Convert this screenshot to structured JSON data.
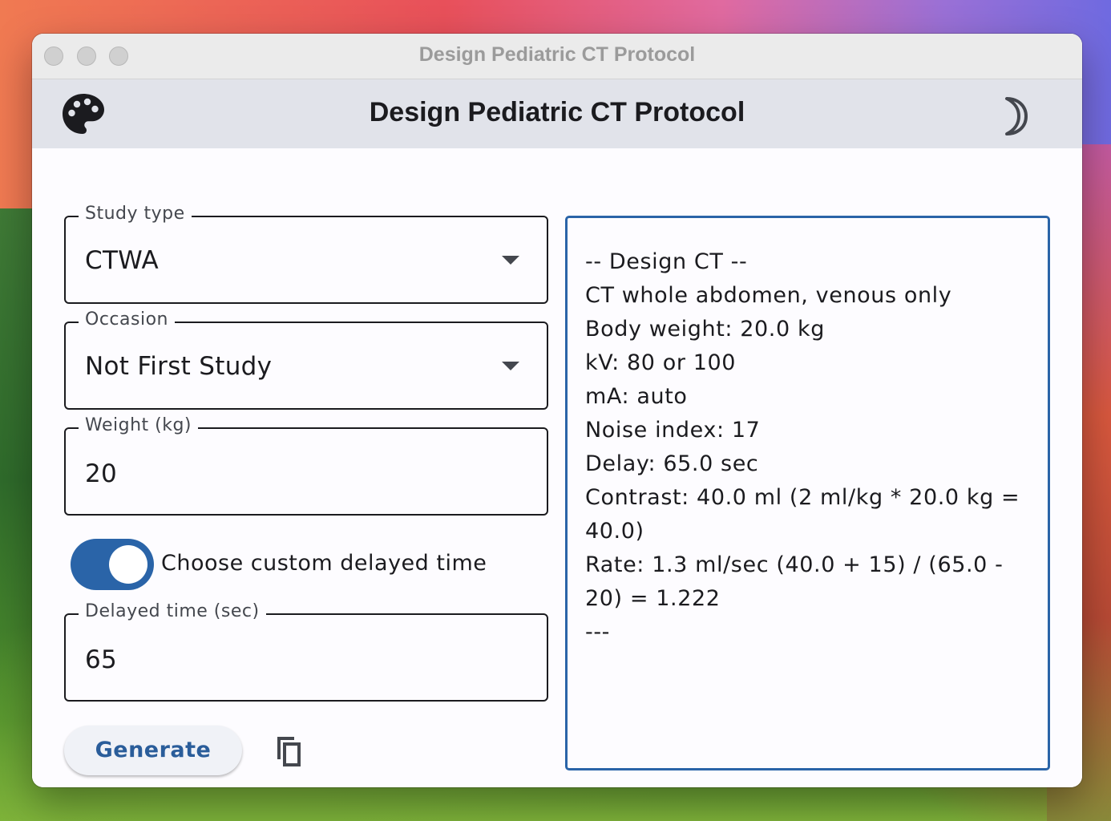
{
  "window": {
    "title": "Design Pediatric CT Protocol"
  },
  "appbar": {
    "title": "Design Pediatric CT Protocol",
    "left_icon": "palette-icon",
    "right_icon": "moon-icon"
  },
  "form": {
    "study_type": {
      "label": "Study type",
      "value": "CTWA"
    },
    "occasion": {
      "label": "Occasion",
      "value": "Not First Study"
    },
    "weight": {
      "label": "Weight (kg)",
      "value": "20"
    },
    "custom_delay_switch": {
      "label": "Choose custom delayed time",
      "checked": true
    },
    "delayed_time": {
      "label": "Delayed time (sec)",
      "value": "65"
    }
  },
  "actions": {
    "generate_label": "Generate",
    "copy_icon": "copy-icon"
  },
  "output": {
    "lines": [
      "-- Design CT --",
      "CT whole abdomen, venous only",
      "Body weight: 20.0 kg",
      "kV: 80 or 100",
      "mA: auto",
      "Noise index: 17",
      "Delay: 65.0 sec",
      "Contrast: 40.0 ml (2 ml/kg * 20.0 kg = 40.0)",
      "Rate: 1.3 ml/sec (40.0 + 15) / (65.0 - 20) = 1.222",
      "---"
    ]
  },
  "colors": {
    "accent": "#2a64a8",
    "appbar_bg": "#e1e3ea",
    "text": "#1b1b1f"
  }
}
